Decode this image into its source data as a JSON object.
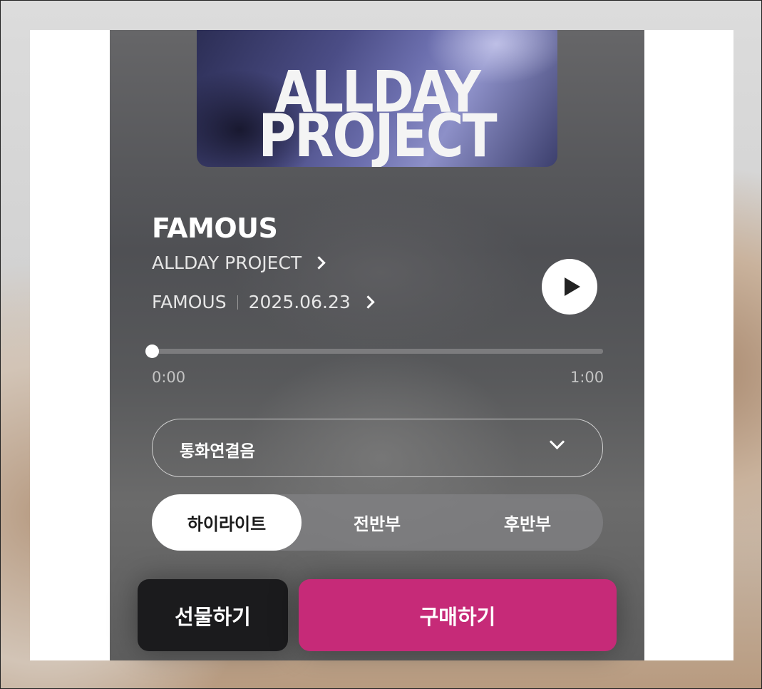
{
  "cover": {
    "line1": "ALLDAY",
    "line2": "PROJECT"
  },
  "track": {
    "title": "FAMOUS",
    "artist": "ALLDAY PROJECT",
    "album": "FAMOUS",
    "release_date": "2025.06.23"
  },
  "player": {
    "play_icon": "play-icon",
    "progress": 0,
    "time_current": "0:00",
    "time_total": "1:00"
  },
  "ringtone_select": {
    "selected": "통화연결음",
    "icon": "chevron-down-icon"
  },
  "segments": {
    "active_index": 0,
    "items": [
      {
        "label": "하이라이트"
      },
      {
        "label": "전반부"
      },
      {
        "label": "후반부"
      }
    ]
  },
  "actions": {
    "gift_label": "선물하기",
    "buy_label": "구매하기",
    "buy_color": "#c62a78",
    "gift_color": "#1b1b1d"
  }
}
